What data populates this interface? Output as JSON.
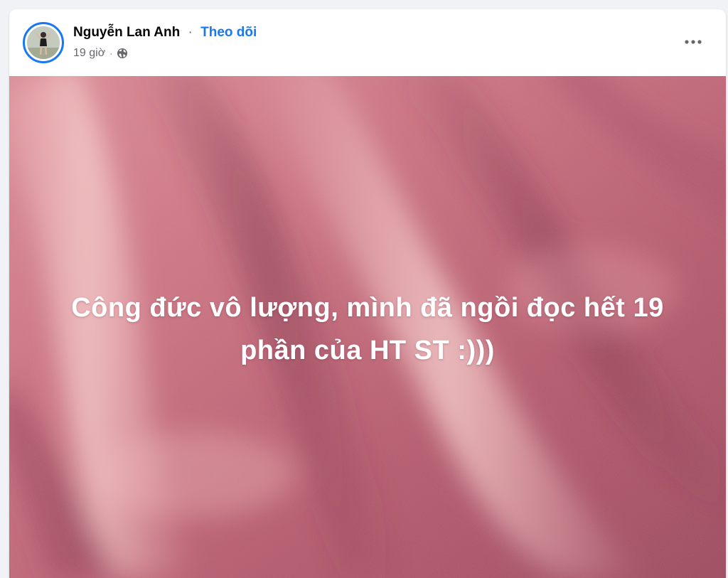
{
  "post": {
    "author_name": "Nguyễn Lan Anh",
    "separator": "·",
    "follow_label": "Theo dõi",
    "timestamp": "19 giờ",
    "meta_separator": "·",
    "privacy_icon": "globe-icon",
    "more_icon": "more-horizontal-icon",
    "content_text": "Công đức vô lượng, mình đã ngồi đọc hết 19 phần của HT ST :)))",
    "background_color": "#c8707f"
  },
  "colors": {
    "accent": "#1877f2",
    "name": "#050505",
    "secondary": "#65676b",
    "page_bg": "#f0f2f5"
  }
}
